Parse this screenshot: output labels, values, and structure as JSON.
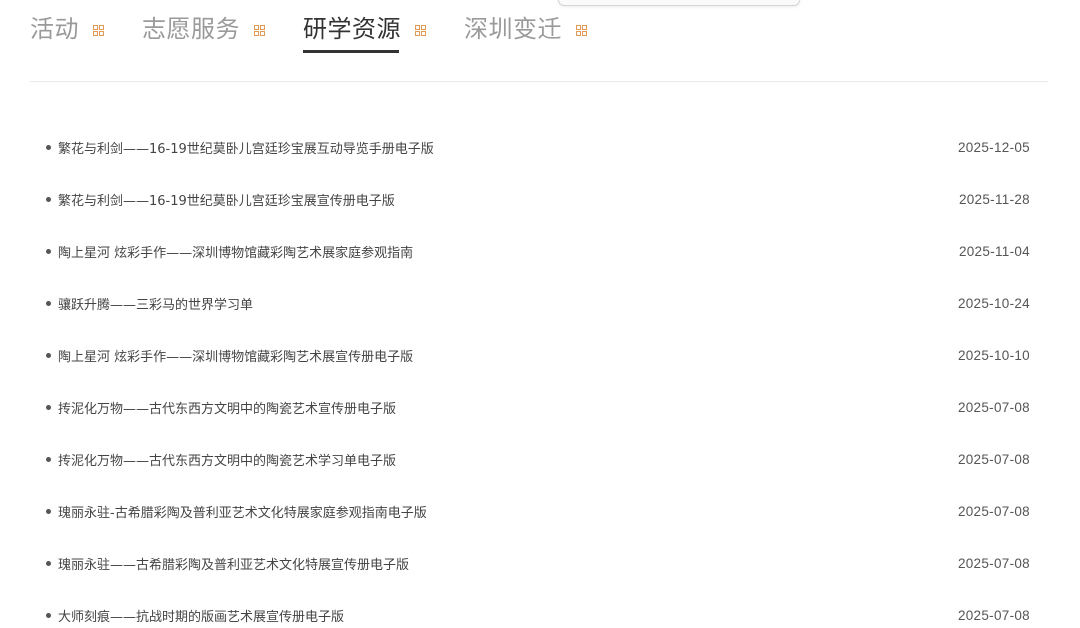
{
  "tabs": [
    {
      "label": "活动",
      "active": false
    },
    {
      "label": "志愿服务",
      "active": false
    },
    {
      "label": "研学资源",
      "active": true
    },
    {
      "label": "深圳变迁",
      "active": false
    }
  ],
  "colors": {
    "accent_icon": "#e39a55",
    "active_tab": "#333333",
    "inactive_tab": "#9a9a9a"
  },
  "list": [
    {
      "title": "繁花与利剑——16-19世纪莫卧儿宫廷珍宝展互动导览手册电子版",
      "date": "2025-12-05"
    },
    {
      "title": "繁花与利剑——16-19世纪莫卧儿宫廷珍宝展宣传册电子版",
      "date": "2025-11-28"
    },
    {
      "title": "陶上星河 炫彩手作——深圳博物馆藏彩陶艺术展家庭参观指南",
      "date": "2025-11-04"
    },
    {
      "title": "骧跃升腾——三彩马的世界学习单",
      "date": "2025-10-24"
    },
    {
      "title": "陶上星河 炫彩手作——深圳博物馆藏彩陶艺术展宣传册电子版",
      "date": "2025-10-10"
    },
    {
      "title": "抟泥化万物——古代东西方文明中的陶瓷艺术宣传册电子版",
      "date": "2025-07-08"
    },
    {
      "title": "抟泥化万物——古代东西方文明中的陶瓷艺术学习单电子版",
      "date": "2025-07-08"
    },
    {
      "title": "瑰丽永驻-古希腊彩陶及普利亚艺术文化特展家庭参观指南电子版",
      "date": "2025-07-08"
    },
    {
      "title": "瑰丽永驻——古希腊彩陶及普利亚艺术文化特展宣传册电子版",
      "date": "2025-07-08"
    },
    {
      "title": "大师刻痕——抗战时期的版画艺术展宣传册电子版",
      "date": "2025-07-08"
    }
  ]
}
